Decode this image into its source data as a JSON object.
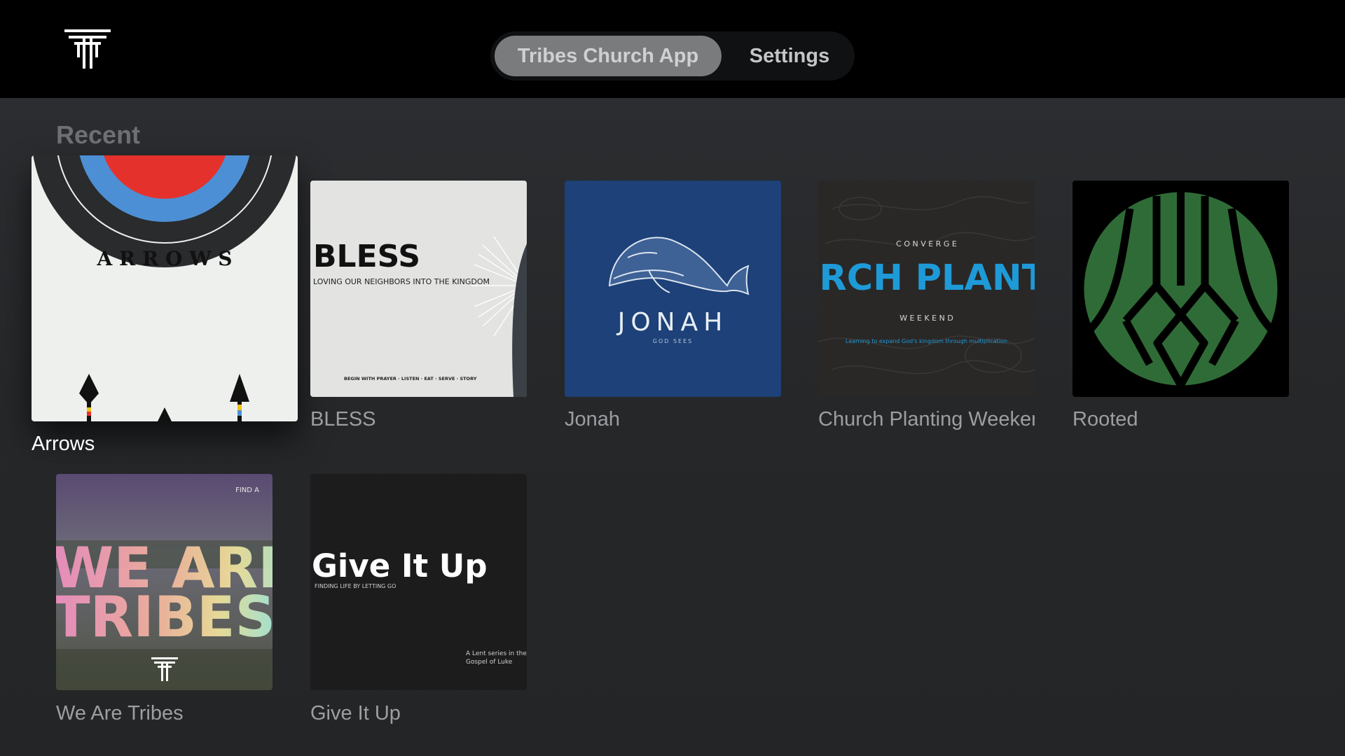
{
  "nav": {
    "tabs": [
      {
        "label": "Tribes Church App",
        "selected": true
      },
      {
        "label": "Settings",
        "selected": false
      }
    ]
  },
  "sections": [
    {
      "title": "Recent",
      "items": [
        {
          "title": "Arrows",
          "focused": true,
          "art": {
            "text": "A R R O W S"
          }
        },
        {
          "title": "BLESS",
          "art": {
            "title": "BLESS",
            "subtitle": "LOVING OUR NEIGHBORS INTO THE KINGDOM",
            "footer": "BEGIN WITH PRAYER · LISTEN · EAT · SERVE · STORY"
          }
        },
        {
          "title": "Jonah",
          "art": {
            "title": "JONAH",
            "subtitle": "GOD SEES"
          }
        },
        {
          "title": "Church Planting Weekend",
          "art": {
            "top": "C O N V E R G E",
            "title": "CHURCH PLANTING",
            "middle": "W E E K E N D",
            "tagline": "Learning to expand God's kingdom through multiplication"
          }
        },
        {
          "title": "Rooted",
          "art": {}
        },
        {
          "title": "We Are Tribes",
          "art": {
            "line1": "WE ARE",
            "line2": "TRIBES",
            "corner": "FIND A"
          }
        },
        {
          "title": "Give It Up",
          "art": {
            "title": "Give It Up",
            "subtitle": "FINDING LIFE BY LETTING GO",
            "note_line1": "A Lent series in the",
            "note_line2": "Gospel of Luke"
          }
        }
      ]
    }
  ],
  "colors": {
    "topbar": "#000000",
    "background": "#26282b",
    "caption": "#9c9ea1",
    "focused_caption": "#ffffff",
    "jonah_blue": "#1d4178",
    "church_planting_blue": "#1e9ad8",
    "rooted_green": "#2f6b36"
  },
  "icons": {
    "logo": "tribes-logo-icon"
  }
}
